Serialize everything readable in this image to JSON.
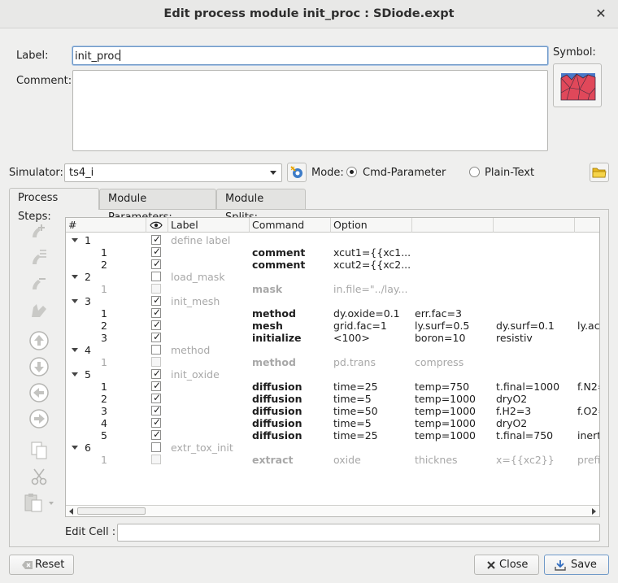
{
  "window": {
    "title": "Edit process module init_proc : SDiode.expt"
  },
  "form": {
    "label_caption": "Label:",
    "label_value": "init_proc",
    "comment_caption": "Comment:",
    "comment_value": "",
    "symbol_caption": "Symbol:"
  },
  "simulator": {
    "caption": "Simulator:",
    "value": "ts4_i",
    "mode_caption": "Mode:",
    "mode_cmd": "Cmd-Parameter",
    "mode_plain": "Plain-Text",
    "selected_mode": "Cmd-Parameter"
  },
  "tabs": [
    {
      "label": "Process Steps:",
      "active": true
    },
    {
      "label": "Module Parameters:",
      "active": false
    },
    {
      "label": "Module Splits:",
      "active": false
    }
  ],
  "grid": {
    "headers": {
      "num": "#",
      "label": "Label",
      "command": "Command",
      "option": "Option"
    },
    "rows": [
      {
        "level": 0,
        "num": "1",
        "checked": true,
        "label": "define label",
        "dim_label": true,
        "command": "",
        "opts": [
          "",
          "",
          "",
          ""
        ]
      },
      {
        "level": 1,
        "num": "1",
        "checked": true,
        "label": "",
        "command": "comment",
        "opts": [
          "xcut1={{xc1...",
          "",
          "",
          ""
        ]
      },
      {
        "level": 1,
        "num": "2",
        "checked": true,
        "label": "",
        "command": "comment",
        "opts": [
          "xcut2={{xc2...",
          "",
          "",
          ""
        ]
      },
      {
        "level": 0,
        "num": "2",
        "checked": false,
        "label": "load_mask",
        "dim_label": true,
        "command": "",
        "opts": [
          "",
          "",
          "",
          ""
        ]
      },
      {
        "level": 1,
        "num": "1",
        "checked": false,
        "disabled": true,
        "label": "",
        "command": "mask",
        "opts": [
          "in.file=\"../lay...",
          "",
          "",
          ""
        ]
      },
      {
        "level": 0,
        "num": "3",
        "checked": true,
        "label": "init_mesh",
        "dim_label": true,
        "command": "",
        "opts": [
          "",
          "",
          "",
          ""
        ]
      },
      {
        "level": 1,
        "num": "1",
        "checked": true,
        "label": "",
        "command": "method",
        "opts": [
          "dy.oxide=0.1",
          "err.fac=3",
          "",
          ""
        ]
      },
      {
        "level": 1,
        "num": "2",
        "checked": true,
        "label": "",
        "command": "mesh",
        "opts": [
          "grid.fac=1",
          "ly.surf=0.5",
          "dy.surf=0.1",
          "ly.ac"
        ]
      },
      {
        "level": 1,
        "num": "3",
        "checked": true,
        "label": "",
        "command": "initialize",
        "opts": [
          "<100>",
          "boron=10",
          "resistiv",
          ""
        ]
      },
      {
        "level": 0,
        "num": "4",
        "checked": false,
        "label": "method",
        "dim_label": true,
        "command": "",
        "opts": [
          "",
          "",
          "",
          ""
        ]
      },
      {
        "level": 1,
        "num": "1",
        "checked": false,
        "disabled": true,
        "label": "",
        "command": "method",
        "opts": [
          "pd.trans",
          "compress",
          "",
          ""
        ]
      },
      {
        "level": 0,
        "num": "5",
        "checked": true,
        "label": "init_oxide",
        "dim_label": true,
        "command": "",
        "opts": [
          "",
          "",
          "",
          ""
        ]
      },
      {
        "level": 1,
        "num": "1",
        "checked": true,
        "label": "",
        "command": "diffusion",
        "opts": [
          "time=25",
          "temp=750",
          "t.final=1000",
          "f.N2="
        ]
      },
      {
        "level": 1,
        "num": "2",
        "checked": true,
        "label": "",
        "command": "diffusion",
        "opts": [
          "time=5",
          "temp=1000",
          "dryO2",
          ""
        ]
      },
      {
        "level": 1,
        "num": "3",
        "checked": true,
        "label": "",
        "command": "diffusion",
        "opts": [
          "time=50",
          "temp=1000",
          "f.H2=3",
          "f.O2="
        ]
      },
      {
        "level": 1,
        "num": "4",
        "checked": true,
        "label": "",
        "command": "diffusion",
        "opts": [
          "time=5",
          "temp=1000",
          "dryO2",
          ""
        ]
      },
      {
        "level": 1,
        "num": "5",
        "checked": true,
        "label": "",
        "command": "diffusion",
        "opts": [
          "time=25",
          "temp=1000",
          "t.final=750",
          "inert"
        ]
      },
      {
        "level": 0,
        "num": "6",
        "checked": false,
        "label": "extr_tox_init",
        "dim_label": true,
        "command": "",
        "opts": [
          "",
          "",
          "",
          ""
        ]
      },
      {
        "level": 1,
        "num": "1",
        "checked": false,
        "disabled": true,
        "label": "",
        "command": "extract",
        "opts": [
          "oxide",
          "thicknes",
          "x={{xc2}}",
          "prefi"
        ]
      }
    ]
  },
  "edit_cell": {
    "caption": "Edit Cell :",
    "value": ""
  },
  "buttons": {
    "reset": "Reset",
    "close": "Close",
    "save": "Save"
  },
  "colors": {
    "accent": "#6f99c8",
    "symbol_fill": "#e0485a",
    "symbol_bg": "#4a78c8"
  }
}
